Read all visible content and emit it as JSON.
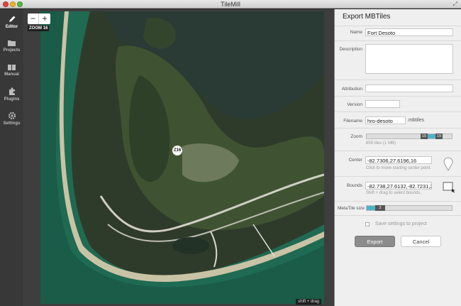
{
  "window": {
    "title": "TileMill"
  },
  "sidebar": {
    "items": [
      {
        "label": "Editor",
        "icon": "pencil-icon",
        "active": true
      },
      {
        "label": "Projects",
        "icon": "folder-icon",
        "active": false
      },
      {
        "label": "Manual",
        "icon": "book-icon",
        "active": false
      },
      {
        "label": "Plugins",
        "icon": "puzzle-icon",
        "active": false
      },
      {
        "label": "Settings",
        "icon": "gear-icon",
        "active": false
      }
    ]
  },
  "map": {
    "zoom_minus": "−",
    "zoom_plus": "+",
    "zoom_label": "ZOOM 16",
    "marker_label": "Z16",
    "shift_hint": "shift + drag"
  },
  "panel": {
    "title": "Export MBTiles",
    "name_label": "Name",
    "name_value": "Fort Desoto",
    "description_label": "Description",
    "description_value": "",
    "attribution_label": "Attribution",
    "attribution_value": "",
    "version_label": "Version",
    "version_value": "",
    "filename_label": "Filename",
    "filename_value": "hro-desoto",
    "filename_suffix": ".mbtiles",
    "zoom_label": "Zoom",
    "zoom_min": "15",
    "zoom_max": "19",
    "zoom_hint": "659 tiles (1 MB)",
    "center_label": "Center",
    "center_value": "-82.7306,27.6196,16",
    "center_hint": "Click to move starting center point.",
    "bounds_label": "Bounds",
    "bounds_value": "-82.738,27.6132,-82.7231,2",
    "bounds_hint": "Shift + drag to select bounds.",
    "metatile_label": "MetaTile size",
    "metatile_value": "2",
    "save_settings_label": "Save settings to project",
    "export_button": "Export",
    "cancel_button": "Cancel"
  },
  "colors": {
    "accent": "#4fb3c8",
    "sidebar_bg": "#383838",
    "panel_bg": "#efefef"
  }
}
